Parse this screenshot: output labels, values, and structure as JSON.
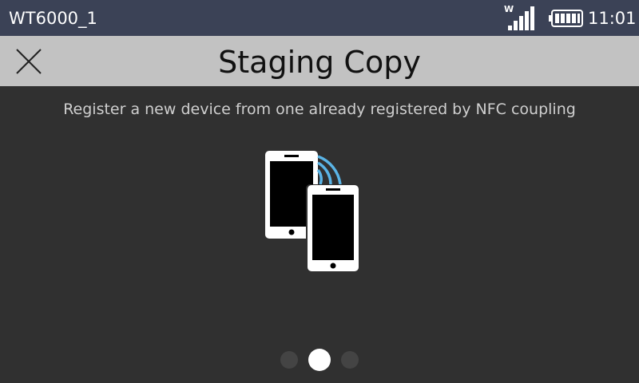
{
  "status_bar": {
    "device_name": "WT6000_1",
    "wifi_badge": "W",
    "time": "11:01",
    "signal_icon": "signal-bars-icon",
    "battery_icon": "battery-full-icon"
  },
  "header": {
    "title": "Staging Copy",
    "close_icon": "close-icon"
  },
  "main": {
    "description": "Register a new device from one already registered by NFC coupling",
    "illustration_icon": "nfc-phones-icon",
    "page_indicator": {
      "total": 3,
      "active": 2
    }
  },
  "colors": {
    "status_bar_bg": "#3b4256",
    "title_bar_bg": "#c2c2c2",
    "content_bg": "#303030",
    "nfc_waves": "#5ab4e6"
  }
}
